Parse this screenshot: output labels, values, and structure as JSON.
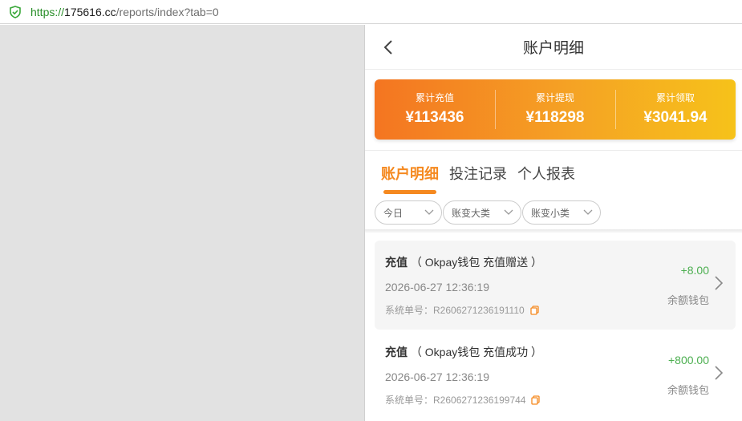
{
  "browser": {
    "url_scheme": "https://",
    "url_host": "175616.cc",
    "url_path": "/reports/index?tab=0"
  },
  "header": {
    "title": "账户明细"
  },
  "summary": {
    "stats": [
      {
        "label": "累计充值",
        "value": "¥113436"
      },
      {
        "label": "累计提现",
        "value": "¥118298"
      },
      {
        "label": "累计领取",
        "value": "¥3041.94"
      }
    ]
  },
  "tabs": [
    {
      "label": "账户明细",
      "active": true
    },
    {
      "label": "投注记录",
      "active": false
    },
    {
      "label": "个人报表",
      "active": false
    }
  ],
  "filters": [
    {
      "label": "今日"
    },
    {
      "label": "账变大类"
    },
    {
      "label": "账变小类"
    }
  ],
  "records": [
    {
      "type": "充值",
      "detail": "（ Okpay钱包 充值赠送 ）",
      "time": "2026-06-27 12:36:19",
      "order_label": "系统单号：",
      "order_no": "R2606271236191110",
      "amount": "+8.00",
      "wallet": "余额钱包"
    },
    {
      "type": "充值",
      "detail": "（ Okpay钱包 充值成功 ）",
      "time": "2026-06-27 12:36:19",
      "order_label": "系统单号：",
      "order_no": "R2606271236199744",
      "amount": "+800.00",
      "wallet": "余额钱包"
    }
  ],
  "colors": {
    "accent": "#f5891f",
    "positive": "#4caf50"
  }
}
